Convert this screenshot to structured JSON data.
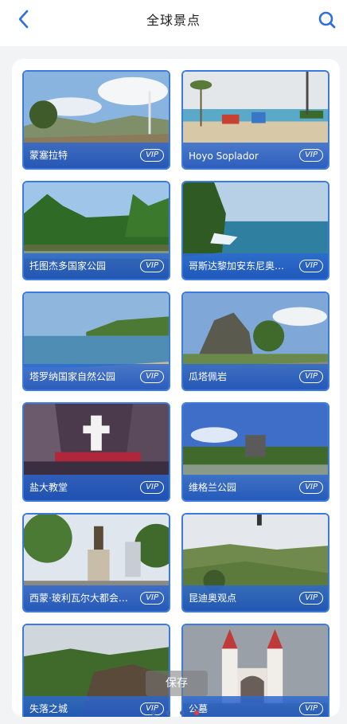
{
  "header": {
    "title": "全球景点",
    "back_icon": "back-chevron-icon",
    "search_icon": "search-icon"
  },
  "accent_color": "#3b7be0",
  "spots": [
    {
      "name": "蒙塞拉特",
      "badge": "VIP"
    },
    {
      "name": "Hoyo Soplador",
      "badge": "VIP"
    },
    {
      "name": "托图杰多国家公园",
      "badge": "VIP"
    },
    {
      "name": "哥斯达黎加安东尼奥…",
      "badge": "VIP"
    },
    {
      "name": "塔罗纳国家自然公园",
      "badge": "VIP"
    },
    {
      "name": "瓜塔佩岩",
      "badge": "VIP"
    },
    {
      "name": "盐大教堂",
      "badge": "VIP"
    },
    {
      "name": "维格兰公园",
      "badge": "VIP"
    },
    {
      "name": "西蒙·玻利瓦尔大都会…",
      "badge": "VIP"
    },
    {
      "name": "昆迪奥观点",
      "badge": "VIP"
    },
    {
      "name": "失落之城",
      "badge": "VIP"
    },
    {
      "name": "公墓",
      "badge": "VIP"
    }
  ],
  "save_button": "保存",
  "pagination": {
    "count": 4,
    "active_index": 4
  }
}
